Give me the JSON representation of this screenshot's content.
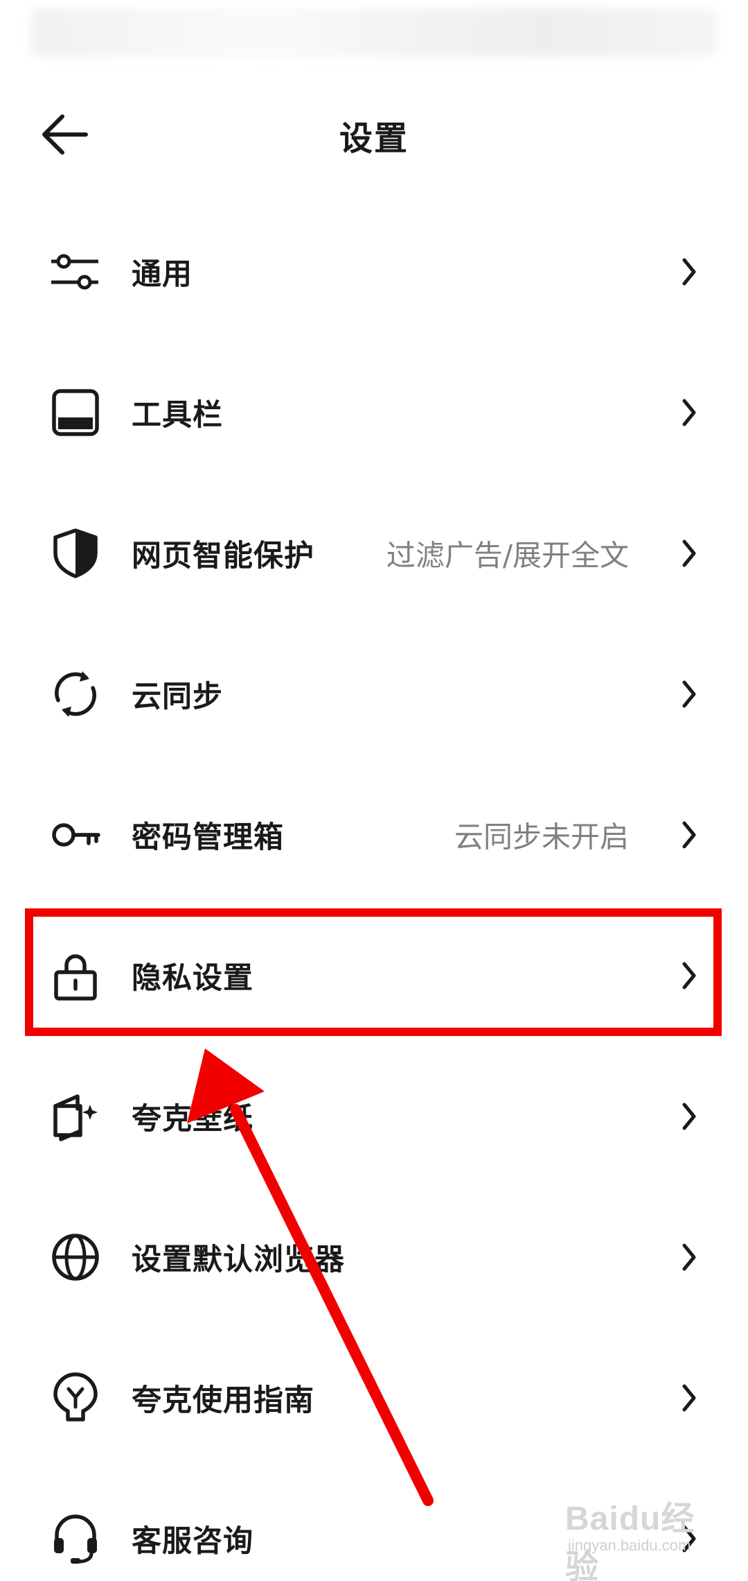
{
  "header": {
    "title": "设置",
    "back_icon": "arrow-left-icon"
  },
  "settings": [
    {
      "label": "通用",
      "value": "",
      "icon": "sliders-icon"
    },
    {
      "label": "工具栏",
      "value": "",
      "icon": "toolbar-icon"
    },
    {
      "label": "网页智能保护",
      "value": "过滤广告/展开全文",
      "icon": "shield-icon"
    },
    {
      "label": "云同步",
      "value": "",
      "icon": "sync-icon"
    },
    {
      "label": "密码管理箱",
      "value": "云同步未开启",
      "icon": "key-icon"
    },
    {
      "label": "隐私设置",
      "value": "",
      "icon": "lock-icon"
    },
    {
      "label": "夸克壁纸",
      "value": "",
      "icon": "wallpaper-icon"
    },
    {
      "label": "设置默认浏览器",
      "value": "",
      "icon": "globe-icon"
    },
    {
      "label": "夸克使用指南",
      "value": "",
      "icon": "bulb-icon"
    },
    {
      "label": "客服咨询",
      "value": "",
      "icon": "headset-icon"
    }
  ],
  "annotation": {
    "highlight_color": "#f20000",
    "highlighted_item": "隐私设置"
  },
  "watermark": {
    "main": "Baidu经验",
    "sub": "jingyan.baidu.com"
  }
}
